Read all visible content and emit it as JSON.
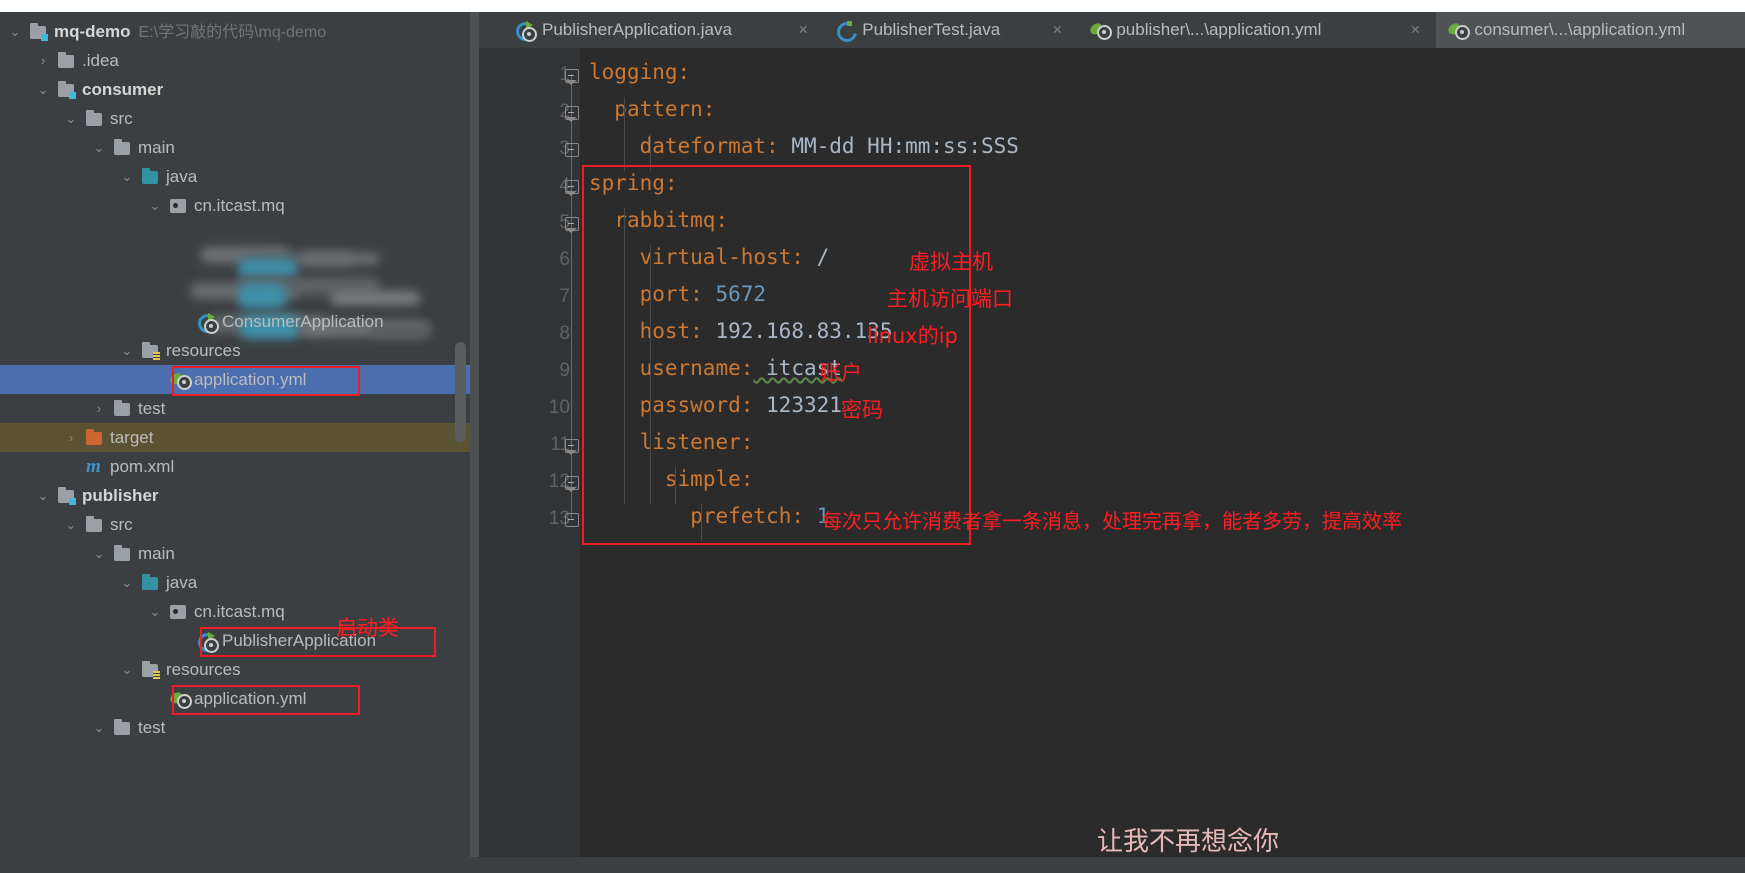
{
  "project": {
    "scrollbar": "project-tree-scrollbar",
    "tree": [
      {
        "id": "mq-demo",
        "label": "mq-demo",
        "path": "E:\\学习敲的代码\\mq-demo",
        "depth": 0,
        "arrow": "v",
        "icon": "module-folder-icon",
        "bold": true
      },
      {
        "id": "idea",
        "label": ".idea",
        "depth": 1,
        "arrow": ">",
        "icon": "folder-icon"
      },
      {
        "id": "consumer",
        "label": "consumer",
        "depth": 1,
        "arrow": "v",
        "icon": "module-folder-icon",
        "bold": true
      },
      {
        "id": "consumer-src",
        "label": "src",
        "depth": 2,
        "arrow": "v",
        "icon": "folder-icon"
      },
      {
        "id": "consumer-main",
        "label": "main",
        "depth": 3,
        "arrow": "v",
        "icon": "folder-icon"
      },
      {
        "id": "consumer-java",
        "label": "java",
        "depth": 4,
        "arrow": "v",
        "icon": "source-folder-icon"
      },
      {
        "id": "consumer-pkg",
        "label": "cn.itcast.mq",
        "depth": 5,
        "arrow": "v",
        "icon": "package-icon"
      },
      {
        "id": "blurred-1",
        "label": "",
        "depth": 6,
        "arrow": "",
        "icon": "blurred-content"
      },
      {
        "id": "blurred-2",
        "label": "",
        "depth": 6,
        "arrow": "",
        "icon": "blurred-content"
      },
      {
        "id": "blurred-3",
        "label": "",
        "depth": 6,
        "arrow": "",
        "icon": "blurred-content"
      },
      {
        "id": "consumer-app",
        "label": "ConsumerApplication",
        "depth": 6,
        "arrow": "",
        "icon": "spring-boot-class-icon"
      },
      {
        "id": "consumer-resources",
        "label": "resources",
        "depth": 4,
        "arrow": "v",
        "icon": "resources-folder-icon"
      },
      {
        "id": "consumer-yml",
        "label": "application.yml",
        "depth": 5,
        "arrow": "",
        "icon": "spring-yaml-icon",
        "selected": true,
        "boxed": true
      },
      {
        "id": "consumer-test",
        "label": "test",
        "depth": 3,
        "arrow": ">",
        "icon": "folder-icon"
      },
      {
        "id": "consumer-target",
        "label": "target",
        "depth": 2,
        "arrow": ">",
        "icon": "excluded-folder-icon",
        "highlight": true
      },
      {
        "id": "consumer-pom",
        "label": "pom.xml",
        "depth": 2,
        "arrow": "",
        "icon": "maven-icon"
      },
      {
        "id": "publisher",
        "label": "publisher",
        "depth": 1,
        "arrow": "v",
        "icon": "module-folder-icon",
        "bold": true
      },
      {
        "id": "publisher-src",
        "label": "src",
        "depth": 2,
        "arrow": "v",
        "icon": "folder-icon"
      },
      {
        "id": "publisher-main",
        "label": "main",
        "depth": 3,
        "arrow": "v",
        "icon": "folder-icon"
      },
      {
        "id": "publisher-java",
        "label": "java",
        "depth": 4,
        "arrow": "v",
        "icon": "source-folder-icon"
      },
      {
        "id": "publisher-pkg",
        "label": "cn.itcast.mq",
        "depth": 5,
        "arrow": "v",
        "icon": "package-icon"
      },
      {
        "id": "publisher-app",
        "label": "PublisherApplication",
        "depth": 6,
        "arrow": "",
        "icon": "spring-boot-class-icon",
        "boxed": true
      },
      {
        "id": "publisher-resources",
        "label": "resources",
        "depth": 4,
        "arrow": "v",
        "icon": "resources-folder-icon"
      },
      {
        "id": "publisher-yml",
        "label": "application.yml",
        "depth": 5,
        "arrow": "",
        "icon": "spring-yaml-icon",
        "boxed": true
      },
      {
        "id": "publisher-test",
        "label": "test",
        "depth": 3,
        "arrow": "v",
        "icon": "folder-icon"
      }
    ],
    "annotation_startup_class": "启动类"
  },
  "editor": {
    "tabs": [
      {
        "id": "tab-publisher-application-java",
        "label": "PublisherApplication.java",
        "icon": "spring-boot-class-icon",
        "close": "×",
        "active": false
      },
      {
        "id": "tab-publisher-test-java",
        "label": "PublisherTest.java",
        "icon": "test-class-icon",
        "close": "×",
        "active": false
      },
      {
        "id": "tab-publisher-application-yml",
        "label": "publisher\\...\\application.yml",
        "icon": "spring-yaml-icon",
        "close": "×",
        "active": false
      },
      {
        "id": "tab-consumer-application-yml",
        "label": "consumer\\...\\application.yml",
        "icon": "spring-yaml-icon",
        "close": "×",
        "active": true
      }
    ],
    "line_numbers": [
      "1",
      "2",
      "3",
      "4",
      "5",
      "6",
      "7",
      "8",
      "9",
      "10",
      "11",
      "12",
      "13"
    ],
    "lines": [
      {
        "n": 1,
        "indent": 0,
        "key": "logging:",
        "value": "",
        "fold": "v"
      },
      {
        "n": 2,
        "indent": 1,
        "key": "pattern:",
        "value": "",
        "fold": "v"
      },
      {
        "n": 3,
        "indent": 2,
        "key": "dateformat:",
        "value": " MM-dd HH:mm:ss:SSS",
        "fold": "u"
      },
      {
        "n": 4,
        "indent": 0,
        "key": "spring:",
        "value": "",
        "fold": "v"
      },
      {
        "n": 5,
        "indent": 1,
        "key": "rabbitmq:",
        "value": "",
        "fold": "v"
      },
      {
        "n": 6,
        "indent": 2,
        "key": "virtual-host:",
        "value": " /",
        "fold": ""
      },
      {
        "n": 7,
        "indent": 2,
        "key": "port:",
        "value": " 5672",
        "numeric": true,
        "fold": ""
      },
      {
        "n": 8,
        "indent": 2,
        "key": "host:",
        "value": " 192.168.83.135",
        "fold": ""
      },
      {
        "n": 9,
        "indent": 2,
        "key": "username:",
        "value": " itcast",
        "spell": true,
        "fold": ""
      },
      {
        "n": 10,
        "indent": 2,
        "key": "password:",
        "value": " 123321",
        "fold": ""
      },
      {
        "n": 11,
        "indent": 2,
        "key": "listener:",
        "value": "",
        "fold": "v"
      },
      {
        "n": 12,
        "indent": 3,
        "key": "simple:",
        "value": "",
        "fold": "v"
      },
      {
        "n": 13,
        "indent": 4,
        "key": "prefetch:",
        "value": " 1",
        "numeric": true,
        "fold": "u"
      }
    ],
    "annotations": [
      {
        "id": "anno-virtual-host",
        "text": "虚拟主机",
        "line": 6
      },
      {
        "id": "anno-port",
        "text": "主机访问端口",
        "line": 7
      },
      {
        "id": "anno-host",
        "text": "linux的ip",
        "line": 8
      },
      {
        "id": "anno-username",
        "text": "账户",
        "line": 9
      },
      {
        "id": "anno-password",
        "text": "密码",
        "line": 10
      },
      {
        "id": "anno-prefetch",
        "text": "每次只允许消费者拿一条消息，处理完再拿，能者多劳，提高效率",
        "line": 13
      }
    ],
    "watermark": "让我不再想念你"
  },
  "colors": {
    "panel_bg": "#3c3f41",
    "editor_bg": "#2b2b2b",
    "gutter_bg": "#313335",
    "selection": "#4b6eaf",
    "annotation_red": "#ee1c25",
    "key_orange": "#cc7832",
    "value_gray": "#a9b7c6",
    "number_blue": "#6897bb",
    "excluded_brown": "#5b5234"
  }
}
